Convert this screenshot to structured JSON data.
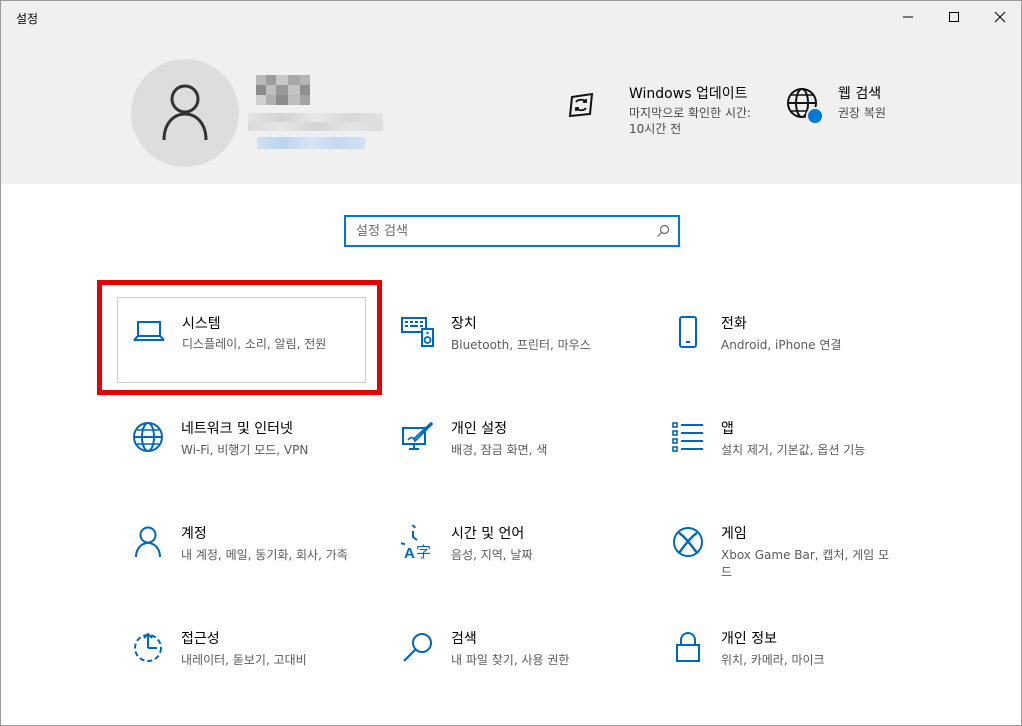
{
  "window": {
    "title": "설정"
  },
  "header": {
    "avatar_icon": "person-icon",
    "quick_links": [
      {
        "icon": "windows-update-icon",
        "title": "Windows 업데이트",
        "subtitle": "마지막으로 확인한 시간: 10시간 전"
      },
      {
        "icon": "globe-icon",
        "title": "웹 검색",
        "subtitle": "권장 복원"
      }
    ]
  },
  "search": {
    "placeholder": "설정 검색"
  },
  "tiles": [
    {
      "icon": "laptop-icon",
      "name": "시스템",
      "desc": "디스플레이, 소리, 알림, 전원"
    },
    {
      "icon": "keyboard-speaker-icon",
      "name": "장치",
      "desc": "Bluetooth, 프린터, 마우스"
    },
    {
      "icon": "phone-icon",
      "name": "전화",
      "desc": "Android, iPhone 연결"
    },
    {
      "icon": "globe-icon",
      "name": "네트워크 및 인터넷",
      "desc": "Wi-Fi, 비행기 모드, VPN"
    },
    {
      "icon": "personalization-icon",
      "name": "개인 설정",
      "desc": "배경, 잠금 화면, 색"
    },
    {
      "icon": "apps-list-icon",
      "name": "앱",
      "desc": "설치 제거, 기본값, 옵션 기능"
    },
    {
      "icon": "person-icon",
      "name": "계정",
      "desc": "내 계정, 메일, 동기화, 회사, 가족"
    },
    {
      "icon": "time-language-icon",
      "name": "시간 및 언어",
      "desc": "음성, 지역, 날짜"
    },
    {
      "icon": "xbox-icon",
      "name": "게임",
      "desc": "Xbox Game Bar, 캡처, 게임 모드"
    },
    {
      "icon": "ease-of-access-icon",
      "name": "접근성",
      "desc": "내레이터, 돋보기, 고대비"
    },
    {
      "icon": "search-icon",
      "name": "검색",
      "desc": "내 파일 찾기, 사용 권한"
    },
    {
      "icon": "lock-icon",
      "name": "개인 정보",
      "desc": "위치, 카메라, 마이크"
    }
  ],
  "colors": {
    "accent": "#0078d7",
    "highlight": "#e60000",
    "header_bg": "#f0f0f0"
  }
}
